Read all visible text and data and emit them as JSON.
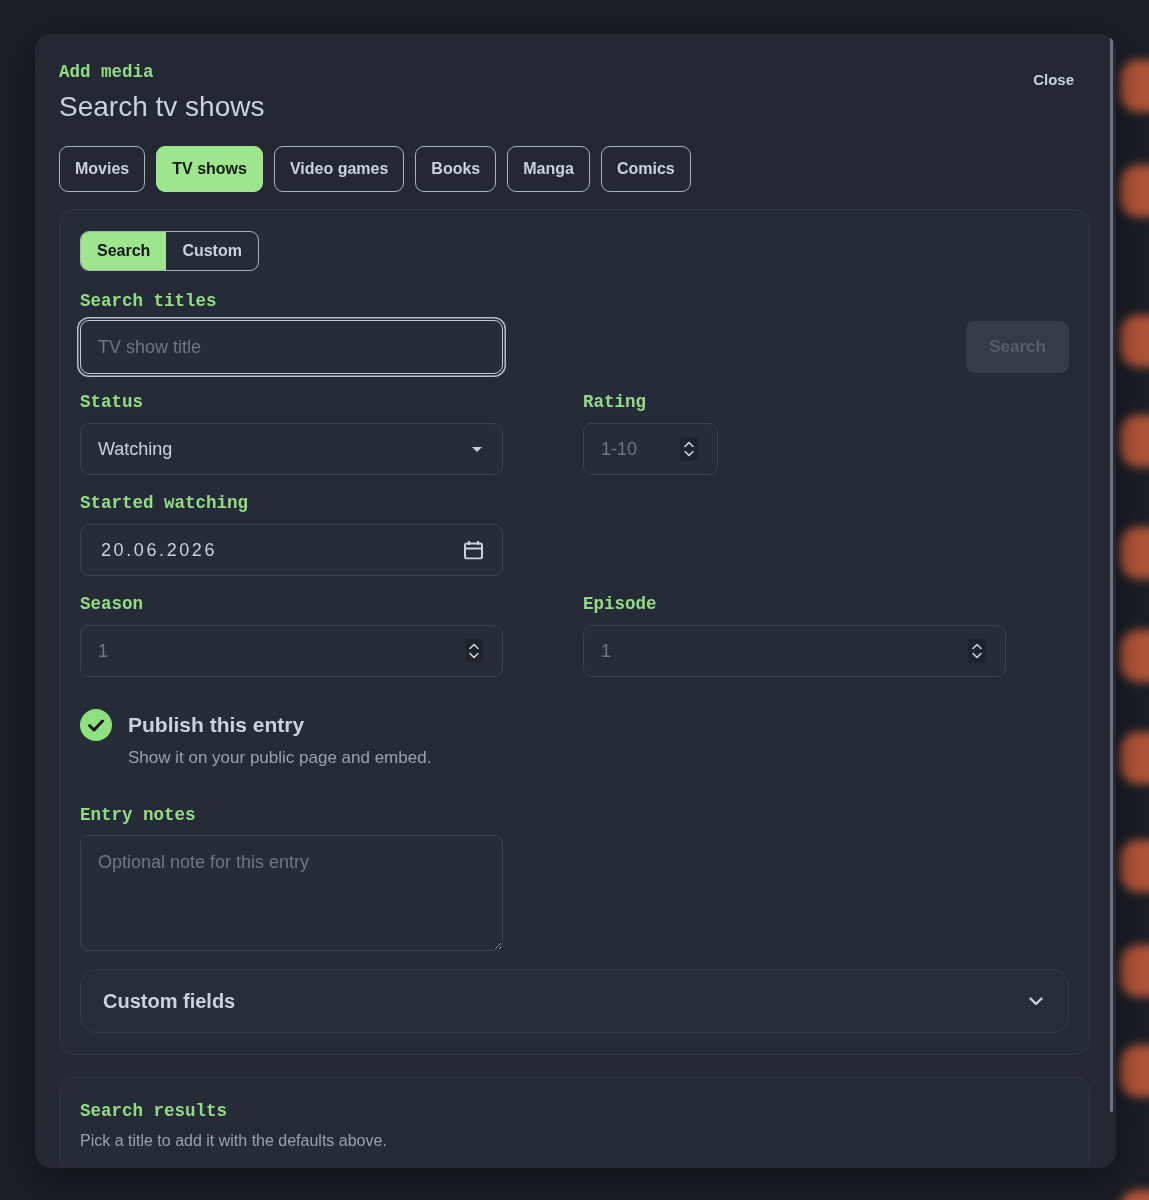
{
  "dialog": {
    "eyebrow": "Add media",
    "title": "Search tv shows",
    "close_label": "Close"
  },
  "media_tabs": [
    {
      "label": "Movies",
      "selected": false
    },
    {
      "label": "TV shows",
      "selected": true
    },
    {
      "label": "Video games",
      "selected": false
    },
    {
      "label": "Books",
      "selected": false
    },
    {
      "label": "Manga",
      "selected": false
    },
    {
      "label": "Comics",
      "selected": false
    }
  ],
  "mode_toggle": [
    {
      "label": "Search",
      "selected": true
    },
    {
      "label": "Custom",
      "selected": false
    }
  ],
  "search": {
    "label": "Search titles",
    "placeholder": "TV show title",
    "focused": true,
    "button_label": "Search",
    "button_disabled": true
  },
  "field_rows": [
    [
      {
        "kind": "select",
        "label": "Status",
        "value": "Watching"
      },
      {
        "kind": "rating",
        "label": "Rating",
        "placeholder": "1-10"
      }
    ],
    [
      {
        "kind": "date",
        "label": "Started watching",
        "value": "20.06.2026"
      }
    ],
    [
      {
        "kind": "number",
        "label": "Season",
        "placeholder": "1"
      },
      {
        "kind": "number",
        "label": "Episode",
        "placeholder": "1"
      }
    ]
  ],
  "publish": {
    "title": "Publish this entry",
    "description": "Show it on your public page and embed.",
    "checked": true
  },
  "notes": {
    "label": "Entry notes",
    "placeholder": "Optional note for this entry"
  },
  "custom_fields": {
    "title": "Custom fields",
    "expanded": false
  },
  "search_results": {
    "title": "Search results",
    "hint": "Pick a title to add it with the defaults above."
  }
}
